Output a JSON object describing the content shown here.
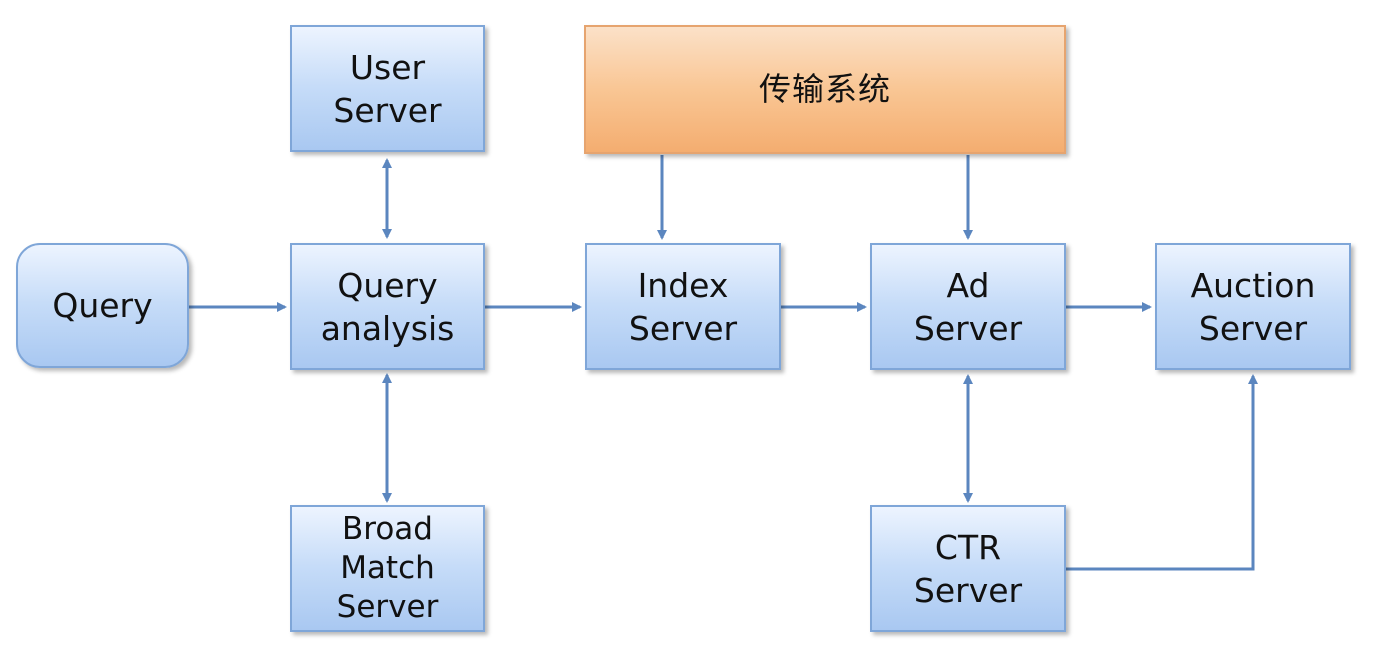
{
  "diagram": {
    "nodes": {
      "query": {
        "label": "Query"
      },
      "user_server": {
        "label": "User\nServer"
      },
      "query_analysis": {
        "label": "Query\nanalysis"
      },
      "broad_match_server": {
        "label": "Broad\nMatch\nServer"
      },
      "transmission_system": {
        "label": "传输系统"
      },
      "index_server": {
        "label": "Index\nServer"
      },
      "ad_server": {
        "label": "Ad\nServer"
      },
      "ctr_server": {
        "label": "CTR\nServer"
      },
      "auction_server": {
        "label": "Auction\nServer"
      }
    },
    "edges": [
      {
        "from": "query",
        "to": "query_analysis",
        "direction": "forward"
      },
      {
        "from": "query_analysis",
        "to": "user_server",
        "direction": "both"
      },
      {
        "from": "query_analysis",
        "to": "broad_match_server",
        "direction": "both"
      },
      {
        "from": "query_analysis",
        "to": "index_server",
        "direction": "forward"
      },
      {
        "from": "transmission_system",
        "to": "index_server",
        "direction": "forward"
      },
      {
        "from": "transmission_system",
        "to": "ad_server",
        "direction": "forward"
      },
      {
        "from": "index_server",
        "to": "ad_server",
        "direction": "forward"
      },
      {
        "from": "ad_server",
        "to": "auction_server",
        "direction": "forward"
      },
      {
        "from": "ad_server",
        "to": "ctr_server",
        "direction": "both"
      },
      {
        "from": "ctr_server",
        "to": "auction_server",
        "direction": "forward"
      }
    ],
    "colors": {
      "node_fill": "#c6dcf8",
      "node_border": "#7fa6d8",
      "accent_fill": "#f9c694",
      "accent_border": "#e6a46f",
      "connector": "#5b86bf"
    }
  }
}
